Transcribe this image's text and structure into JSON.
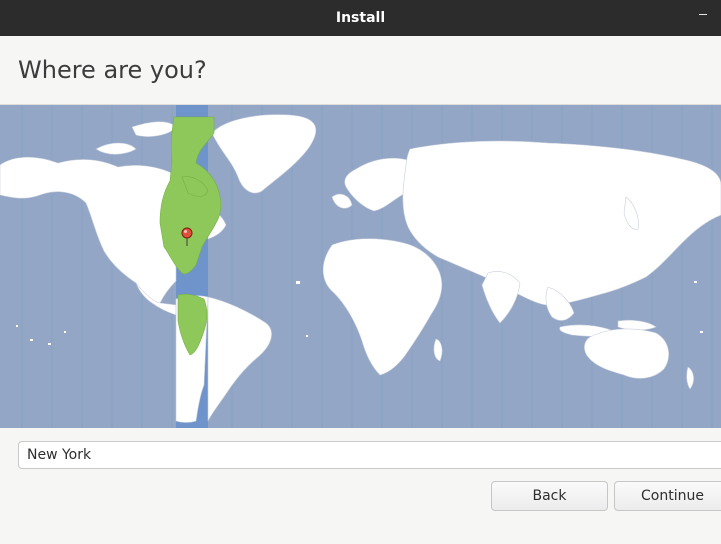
{
  "window": {
    "title": "Install"
  },
  "page": {
    "heading": "Where are you?"
  },
  "map": {
    "selected_city": "New York",
    "colors": {
      "ocean": "#93a6c6",
      "land": "#ffffff",
      "highlight_band": "#6f93cb",
      "highlight_land": "#8ec85a",
      "pin": "#e0503c"
    }
  },
  "location_input": {
    "value": "New York"
  },
  "buttons": {
    "back": "Back",
    "continue": "Continue"
  }
}
